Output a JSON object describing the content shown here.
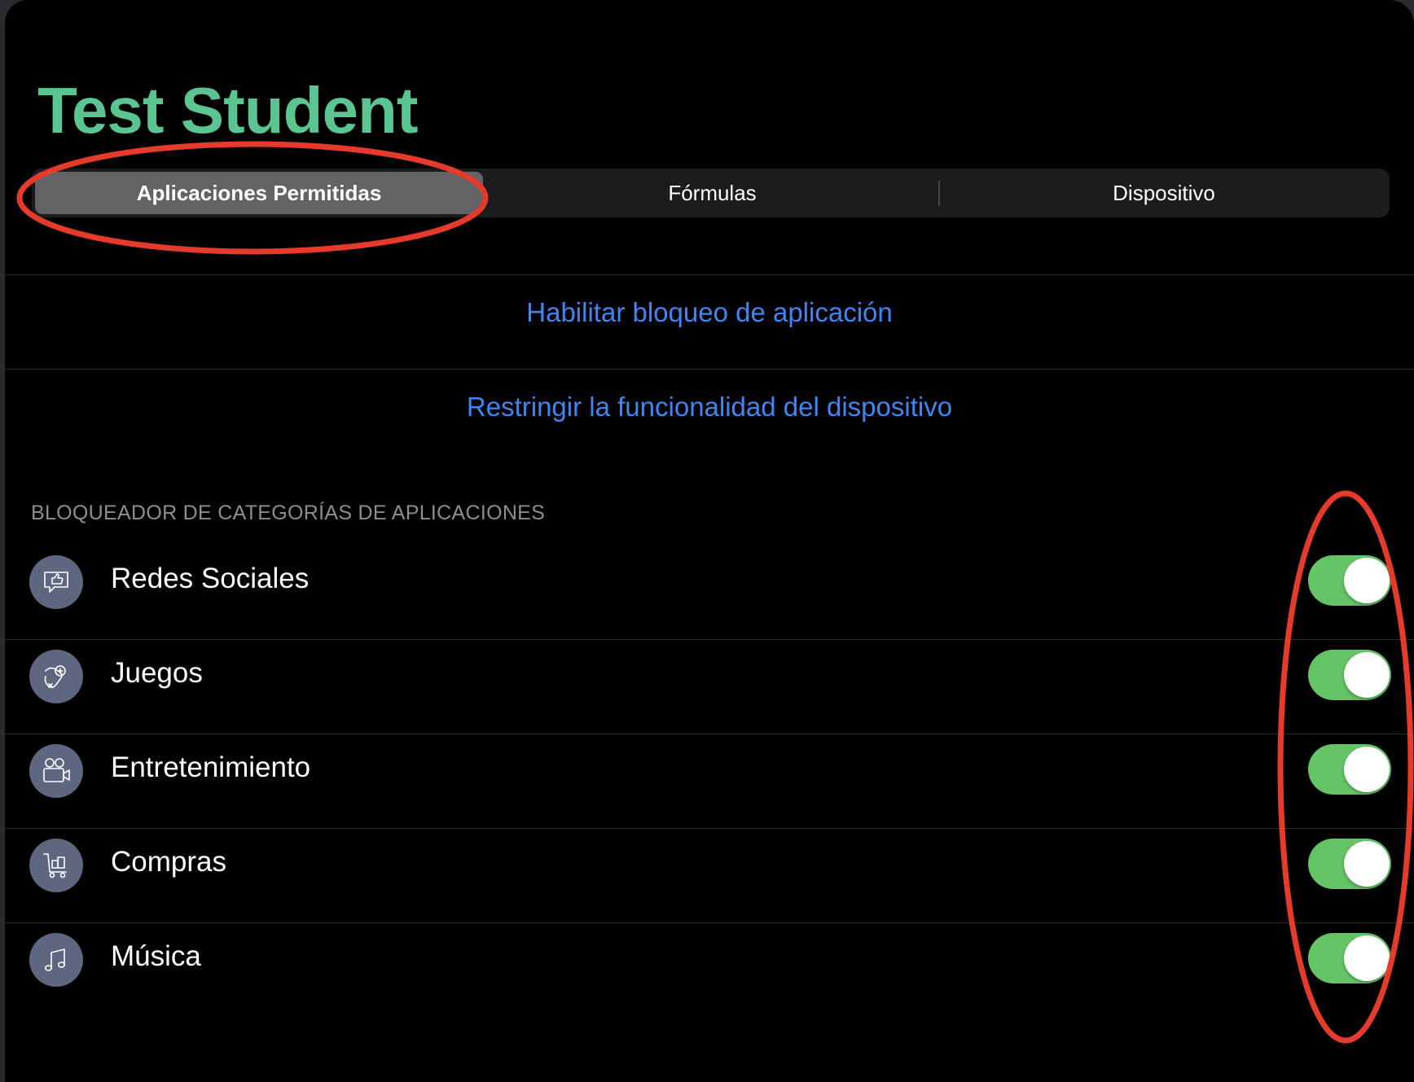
{
  "header": {
    "title": "Test Student"
  },
  "tabs": [
    {
      "label": "Aplicaciones Permitidas",
      "selected": true
    },
    {
      "label": "Fórmulas",
      "selected": false
    },
    {
      "label": "Dispositivo",
      "selected": false
    }
  ],
  "actions": {
    "enable_app_lock": "Habilitar bloqueo de aplicación",
    "restrict_device": "Restringir la funcionalidad del dispositivo"
  },
  "category_blocker": {
    "header": "BLOQUEADOR DE CATEGORÍAS DE APLICACIONES",
    "items": [
      {
        "label": "Redes Sociales",
        "icon": "social-media-icon",
        "enabled": true
      },
      {
        "label": "Juegos",
        "icon": "games-controller-icon",
        "enabled": true
      },
      {
        "label": "Entretenimiento",
        "icon": "entertainment-camera-icon",
        "enabled": true
      },
      {
        "label": "Compras",
        "icon": "shopping-cart-icon",
        "enabled": true
      },
      {
        "label": "Música",
        "icon": "music-note-icon",
        "enabled": true
      }
    ]
  },
  "colors": {
    "title": "#5ac591",
    "link": "#3f86f5",
    "toggle_on": "#65c466",
    "annotation": "#e63a2a"
  }
}
